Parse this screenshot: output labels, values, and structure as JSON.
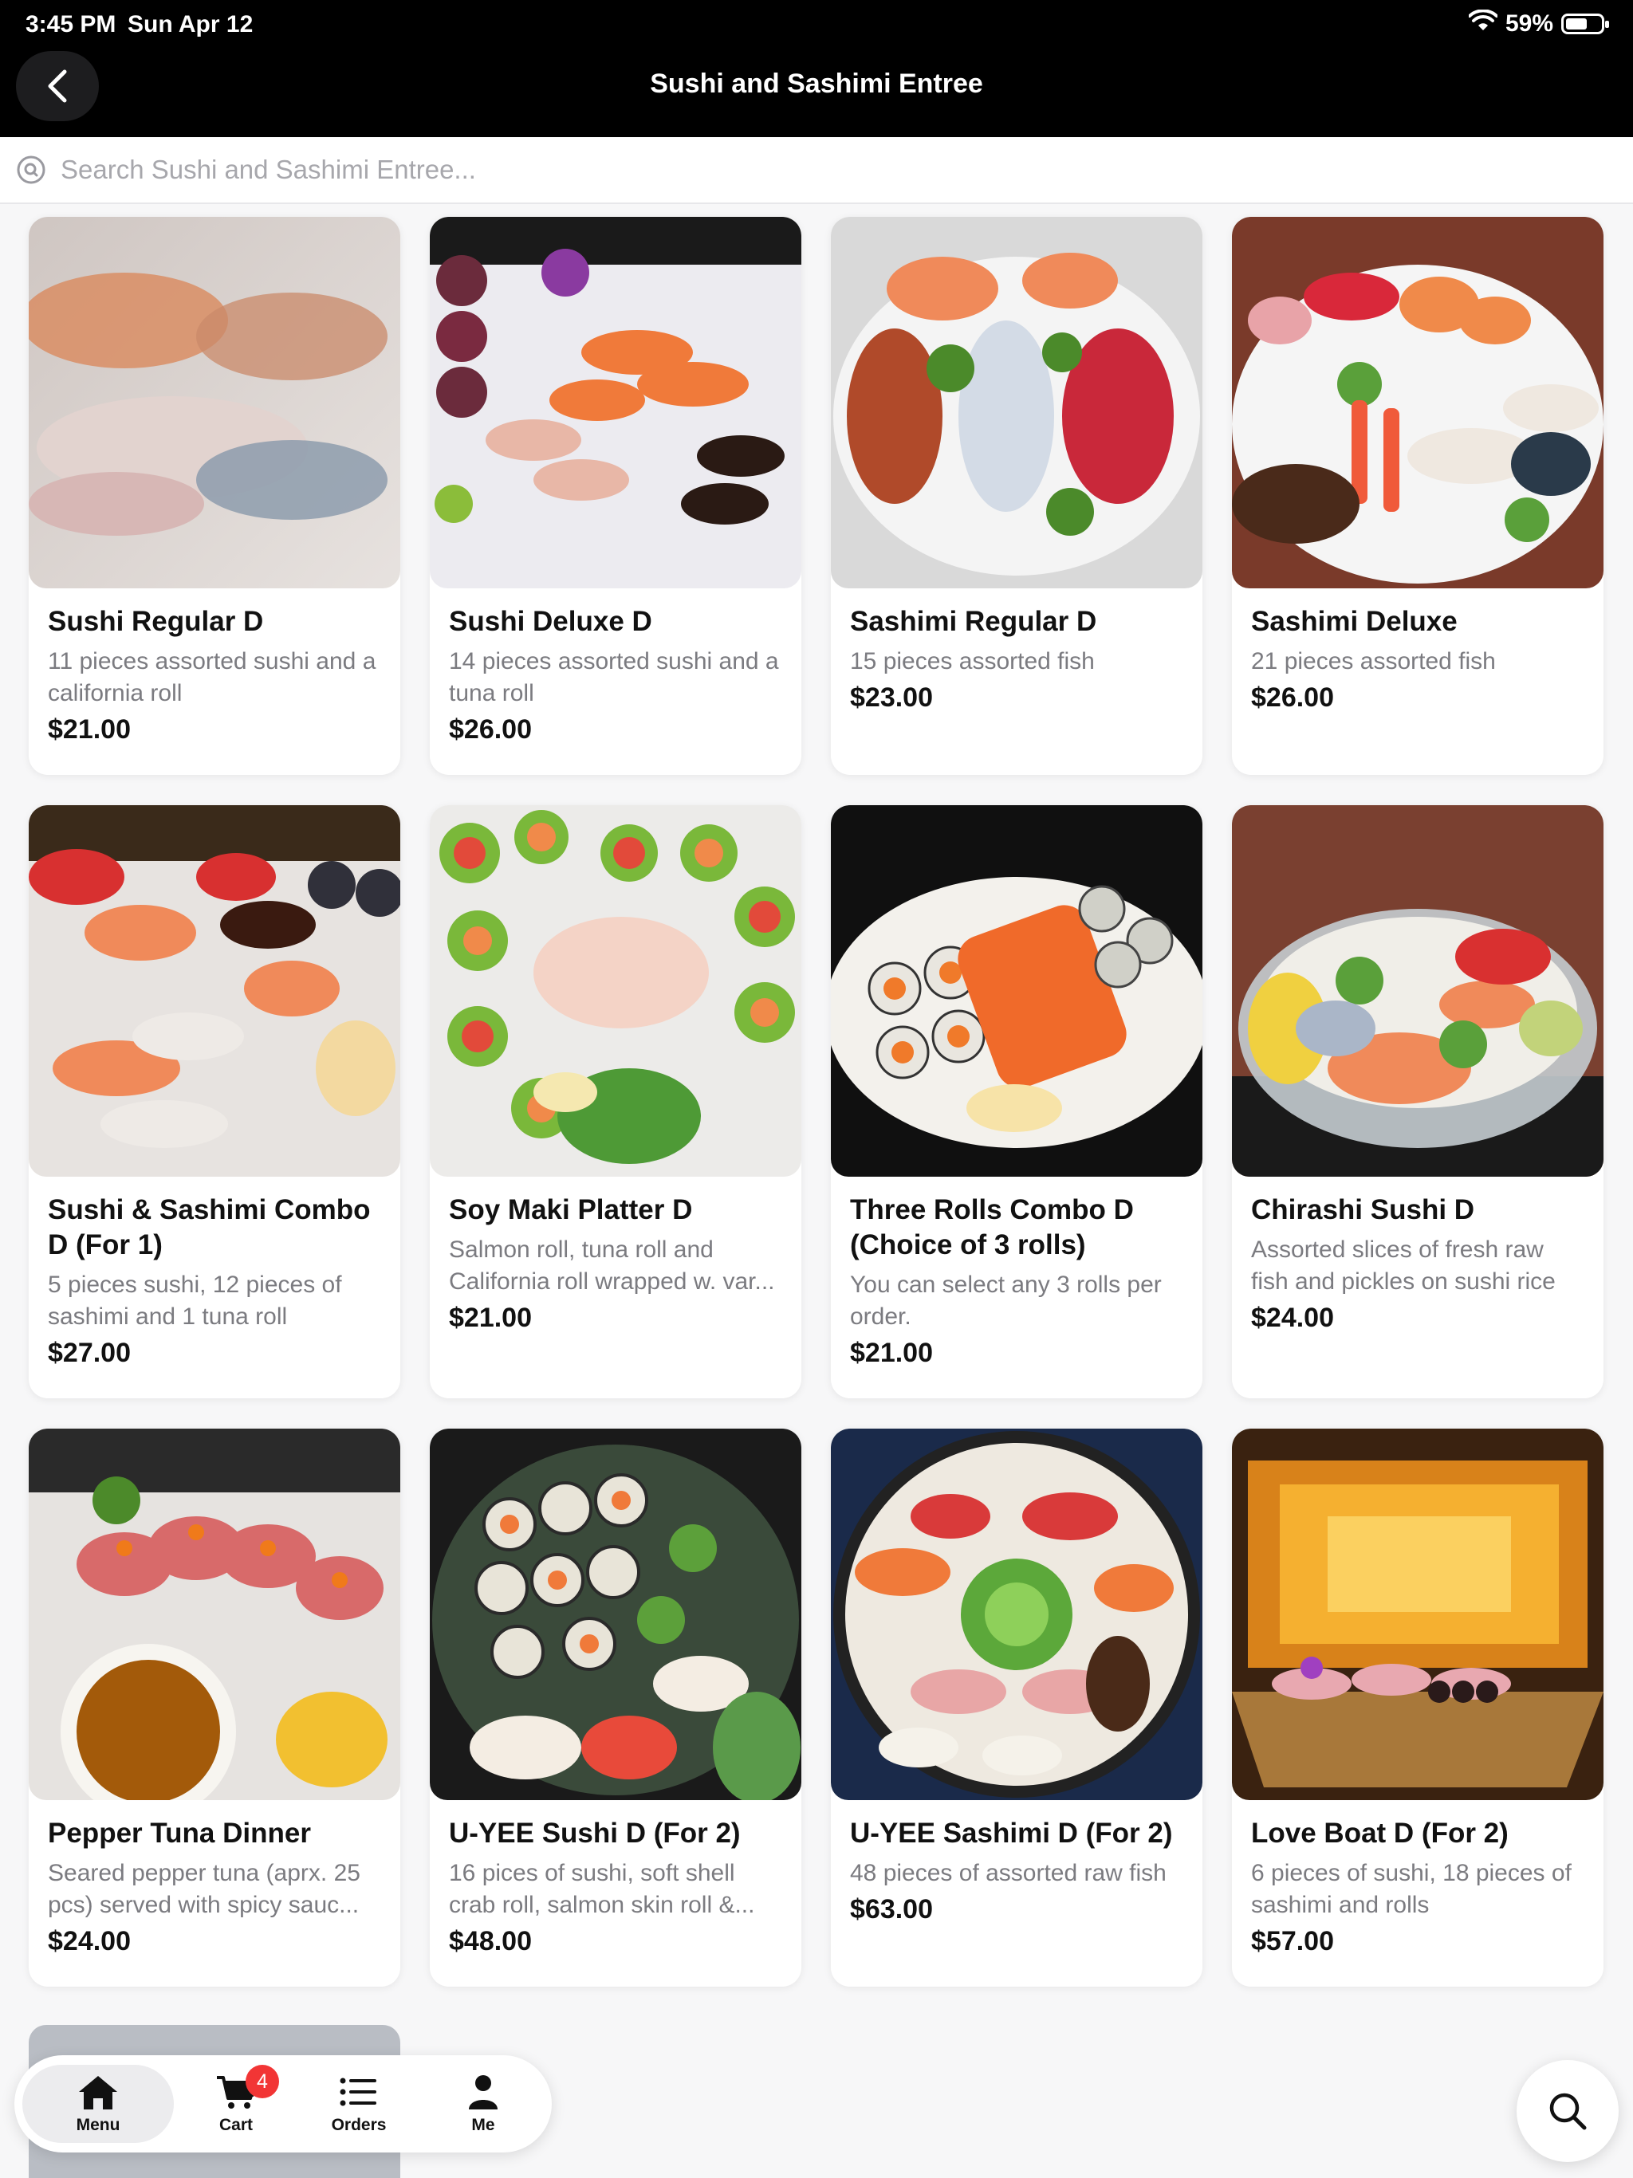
{
  "status": {
    "time": "3:45 PM",
    "date": "Sun Apr 12",
    "battery": "59%"
  },
  "header": {
    "title": "Sushi and Sashimi Entree"
  },
  "search": {
    "placeholder": "Search Sushi and Sashimi Entree..."
  },
  "items": [
    {
      "name": "Sushi Regular D",
      "desc": "11 pieces assorted sushi and a california roll",
      "price": "$21.00"
    },
    {
      "name": "Sushi Deluxe D",
      "desc": "14 pieces assorted sushi and a tuna roll",
      "price": "$26.00"
    },
    {
      "name": "Sashimi Regular D",
      "desc": "15 pieces assorted fish",
      "price": "$23.00"
    },
    {
      "name": "Sashimi Deluxe",
      "desc": "21 pieces assorted fish",
      "price": "$26.00"
    },
    {
      "name": "Sushi & Sashimi Combo D (For 1)",
      "desc": "5 pieces sushi, 12 pieces of sashimi and 1 tuna roll",
      "price": "$27.00"
    },
    {
      "name": "Soy Maki Platter D",
      "desc": "Salmon roll, tuna roll and California roll wrapped w. var...",
      "price": "$21.00"
    },
    {
      "name": "Three Rolls Combo D (Choice of 3 rolls)",
      "desc": "You can select any 3 rolls per order.",
      "price": "$21.00"
    },
    {
      "name": "Chirashi Sushi D",
      "desc": "Assorted slices of fresh raw fish and pickles on sushi rice",
      "price": "$24.00"
    },
    {
      "name": "Pepper Tuna Dinner",
      "desc": "Seared pepper tuna (aprx. 25 pcs) served with spicy sauc...",
      "price": "$24.00"
    },
    {
      "name": "U-YEE Sushi D (For 2)",
      "desc": "16 pices of sushi, soft shell crab roll, salmon skin roll &...",
      "price": "$48.00"
    },
    {
      "name": "U-YEE Sashimi D (For 2)",
      "desc": "48 pieces of assorted raw fish",
      "price": "$63.00"
    },
    {
      "name": "Love Boat  D (For 2)",
      "desc": "6 pieces of sushi, 18 pieces of sashimi and rolls",
      "price": "$57.00"
    }
  ],
  "tabs": {
    "menu": "Menu",
    "cart": "Cart",
    "cart_badge": "4",
    "orders": "Orders",
    "me": "Me"
  },
  "colors": {
    "accent": "#f23535",
    "header_bg": "#000000"
  }
}
